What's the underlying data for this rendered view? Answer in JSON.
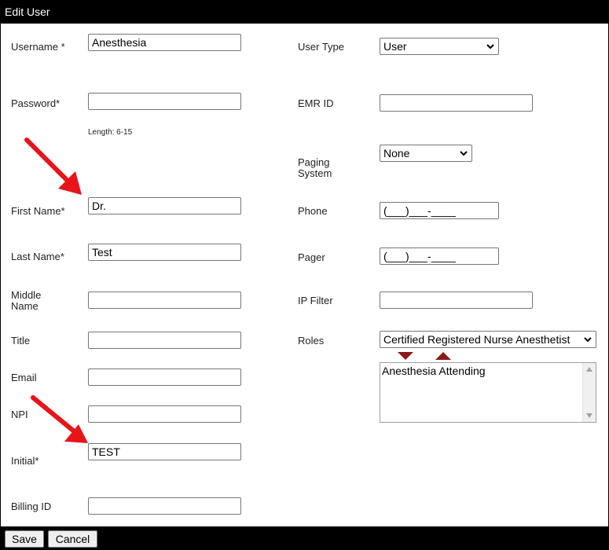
{
  "window": {
    "title": "Edit User"
  },
  "left": {
    "username": {
      "label": "Username *",
      "value": "Anesthesia"
    },
    "password": {
      "label": "Password*",
      "value": "",
      "hint": "Length: 6-15"
    },
    "first_name": {
      "label": "First Name*",
      "value": "Dr."
    },
    "last_name": {
      "label": "Last Name*",
      "value": "Test"
    },
    "middle_name": {
      "label_line1": "Middle",
      "label_line2": "Name",
      "value": ""
    },
    "title": {
      "label": "Title",
      "value": ""
    },
    "email": {
      "label": "Email",
      "value": ""
    },
    "npi": {
      "label": "NPI",
      "value": ""
    },
    "initial": {
      "label": "Initial*",
      "value": "TEST"
    },
    "billing_id": {
      "label": "Billing ID",
      "value": ""
    }
  },
  "right": {
    "user_type": {
      "label": "User Type",
      "selected": "User"
    },
    "emr_id": {
      "label": "EMR ID",
      "value": ""
    },
    "paging_system": {
      "label_line1": "Paging",
      "label_line2": "System",
      "selected": "None"
    },
    "phone": {
      "label": "Phone",
      "value": "(___)___-____"
    },
    "pager": {
      "label": "Pager",
      "value": "(___)___-____"
    },
    "ip_filter": {
      "label": "IP Filter",
      "value": ""
    },
    "roles": {
      "label": "Roles",
      "selected": "Certified Registered Nurse Anesthetist",
      "assigned": [
        "Anesthesia Attending"
      ]
    }
  },
  "footer": {
    "save_label": "Save",
    "cancel_label": "Cancel"
  },
  "colors": {
    "bar": "#000000",
    "annotation_arrow": "#e8141a",
    "role_arrow": "#8b1a1a"
  },
  "icons": [
    "chevron-down-icon",
    "move-down-icon",
    "move-up-icon",
    "annotation-arrow"
  ]
}
